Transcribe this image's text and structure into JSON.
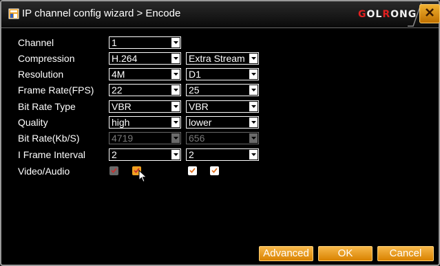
{
  "window": {
    "title": "IP channel config wizard > Encode",
    "logo_red": "G",
    "logo_a": "OL",
    "logo_b": "R",
    "logo_c": "ONG",
    "close_icon": "close-icon"
  },
  "form": {
    "channel": {
      "label": "Channel",
      "value": "1"
    },
    "compression": {
      "label": "Compression",
      "main": "H.264",
      "extra": "Extra Stream"
    },
    "resolution": {
      "label": "Resolution",
      "main": "4M",
      "extra": "D1"
    },
    "frame_rate": {
      "label": "Frame Rate(FPS)",
      "main": "22",
      "extra": "25"
    },
    "bit_rate_type": {
      "label": "Bit Rate Type",
      "main": "VBR",
      "extra": "VBR"
    },
    "quality": {
      "label": "Quality",
      "main": "high",
      "extra": "lower"
    },
    "bit_rate": {
      "label": "Bit Rate(Kb/S)",
      "main": "4719",
      "extra": "656"
    },
    "i_frame": {
      "label": "I Frame Interval",
      "main": "2",
      "extra": "2"
    },
    "video_audio": {
      "label": "Video/Audio"
    }
  },
  "buttons": {
    "advanced": "Advanced",
    "ok": "OK",
    "cancel": "Cancel"
  },
  "colors": {
    "accent": "#f0a020",
    "logo_red": "#e02020"
  }
}
